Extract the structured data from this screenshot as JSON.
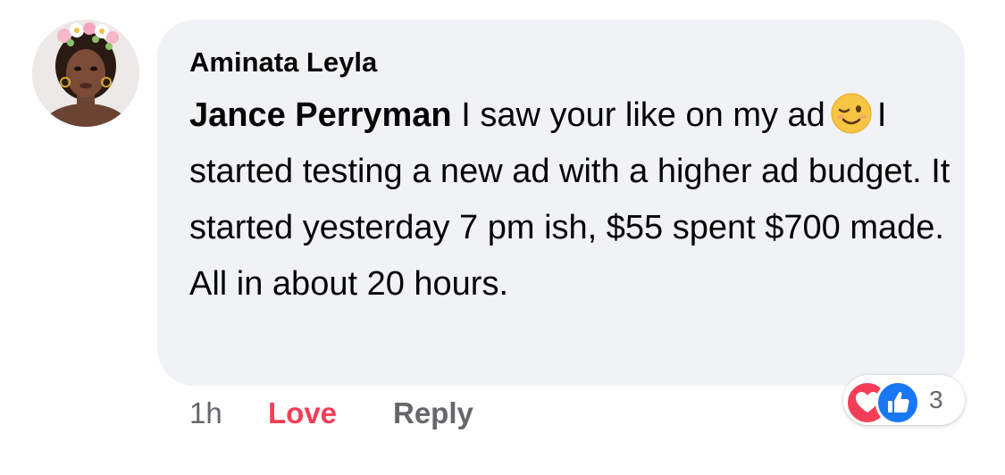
{
  "comment": {
    "author": "Aminata Leyla",
    "mention": "Jance Perryman",
    "text_before_emoji": " I saw your like on my ad",
    "emoji": "winking-face-emoji",
    "text_after_emoji": "I started testing a new ad with a higher ad budget. It started yesterday 7 pm ish, $55 spent $700 made. All in about 20 hours."
  },
  "actions": {
    "time": "1h",
    "love_label": "Love",
    "reply_label": "Reply"
  },
  "reactions": {
    "icons": [
      "heart-reaction-icon",
      "like-reaction-icon"
    ],
    "count": "3"
  },
  "colors": {
    "bubble_bg": "#f0f2f5",
    "love": "#f33e58",
    "like": "#1877f2",
    "secondary_text": "#65676b"
  }
}
